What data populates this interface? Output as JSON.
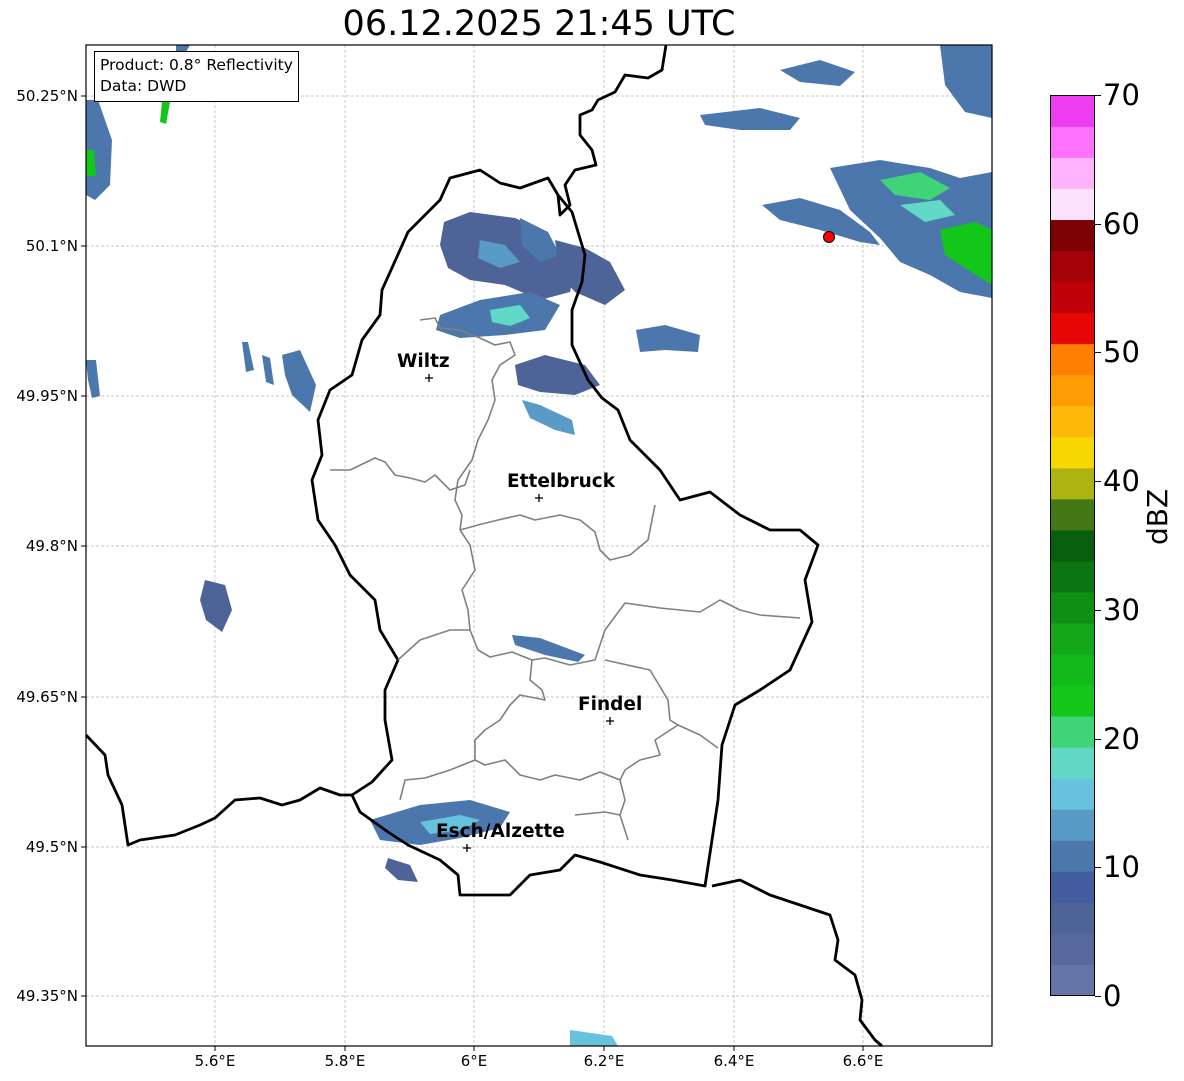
{
  "title": "06.12.2025 21:45 UTC",
  "info": {
    "product": "Product: 0.8° Reflectivity",
    "data": "Data: DWD"
  },
  "axes": {
    "lat_labels": [
      "50.25°N",
      "50.1°N",
      "49.95°N",
      "49.8°N",
      "49.65°N",
      "49.5°N",
      "49.35°N"
    ],
    "lon_labels": [
      "5.6°E",
      "5.8°E",
      "6°E",
      "6.2°E",
      "6.4°E",
      "6.6°E"
    ],
    "grid": true
  },
  "cities": [
    {
      "name": "Wiltz"
    },
    {
      "name": "Ettelbruck"
    },
    {
      "name": "Findel"
    },
    {
      "name": "Esch/Alzette"
    }
  ],
  "colorbar": {
    "label": "dBZ",
    "ticks": [
      "0",
      "10",
      "20",
      "30",
      "40",
      "50",
      "60",
      "70"
    ],
    "colors": [
      "#6575a7",
      "#57689f",
      "#4e6398",
      "#435d9e",
      "#4c77ad",
      "#5a9ac7",
      "#67c2de",
      "#62d8c6",
      "#3fd478",
      "#13c71a",
      "#13b81a",
      "#12a818",
      "#108f15",
      "#0b7611",
      "#075f0d",
      "#447816",
      "#adb310",
      "#f8d602",
      "#fdb80a",
      "#fd9c03",
      "#fe7f01",
      "#e60705",
      "#c00008",
      "#a30307",
      "#7d0003",
      "#fde2fd",
      "#ffb4fc",
      "#ff72fe",
      "#ee3df0"
    ]
  },
  "radar_marker": {
    "color": "#ff0000"
  }
}
